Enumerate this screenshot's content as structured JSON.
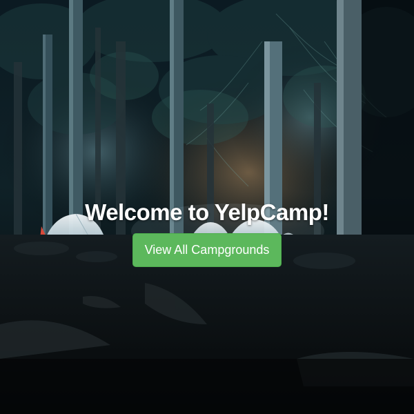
{
  "hero": {
    "title": "Welcome to YelpCamp!",
    "button_label": "View All Campgrounds"
  },
  "colors": {
    "button_bg": "#5cb85c",
    "button_border": "#4cae4c",
    "title_text": "#ffffff",
    "background_dark": "#05090c"
  },
  "background": {
    "image_subject": "night-forest-campsite-with-glowing-tents"
  }
}
